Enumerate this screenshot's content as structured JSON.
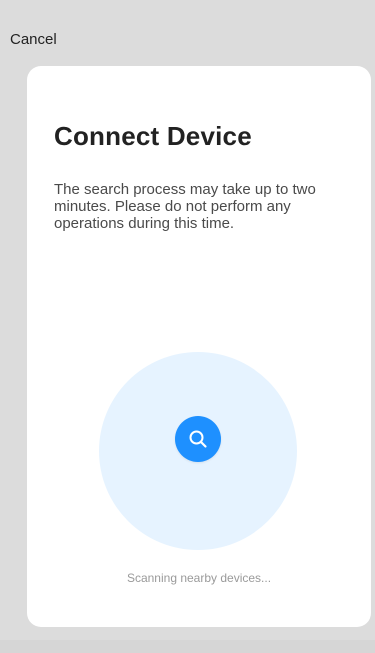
{
  "header": {
    "cancel_label": "Cancel"
  },
  "dialog": {
    "title": "Connect Device",
    "description": "The search process may take up to two minutes. Please do not perform any operations during this time.",
    "status": "Scanning nearby devices..."
  },
  "icons": {
    "search": "search-icon"
  },
  "colors": {
    "background": "#dcdcdc",
    "card": "#ffffff",
    "accent": "#1e90ff",
    "radar": "#e6f3ff",
    "muted_text": "#9a9a9a"
  }
}
